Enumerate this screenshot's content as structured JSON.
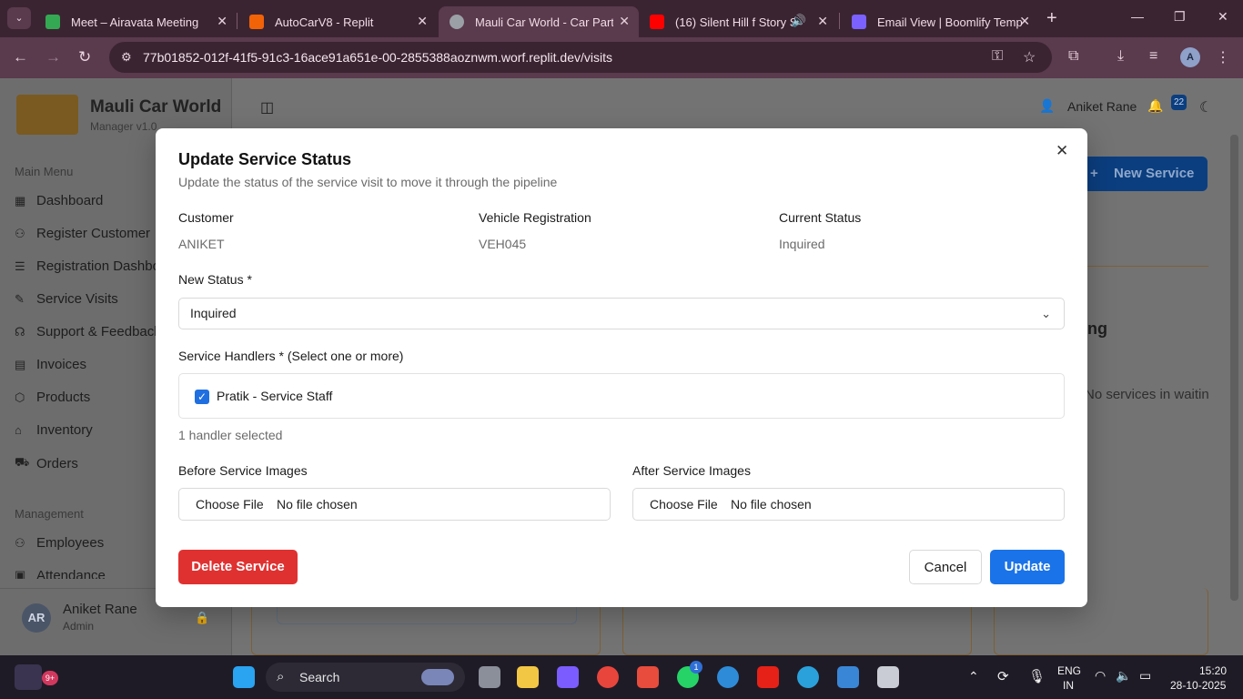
{
  "browser": {
    "tabs": [
      {
        "title": "Meet – Airavata Meeting",
        "favicon_color": "#34a853"
      },
      {
        "title": "AutoCarV8 - Replit",
        "favicon_color": "#f26207"
      },
      {
        "title": "Mauli Car World - Car Parts & ...",
        "favicon_color": "#9aa0a6"
      },
      {
        "title": "(16) Silent Hill f Story Su...",
        "favicon_color": "#ff0000"
      },
      {
        "title": "Email View | Boomlify Tempo...",
        "favicon_color": "#7b61ff"
      }
    ],
    "url": "77b01852-012f-41f5-91c3-16ace91a651e-00-2855388aoznwm.worf.replit.dev/visits",
    "profile_initial": "A"
  },
  "app": {
    "brand": "Mauli Car World",
    "brand_sub": "Manager v1.0",
    "main_menu_label": "Main Menu",
    "menu": [
      "Dashboard",
      "Register Customer",
      "Registration Dashboard",
      "Service Visits",
      "Support & Feedback",
      "Invoices",
      "Products",
      "Inventory",
      "Orders"
    ],
    "management_label": "Management",
    "management": [
      "Employees",
      "Attendance"
    ],
    "user_initials": "AR",
    "user_name": "Aniket Rane",
    "user_role": "Admin",
    "top_user": "Aniket Rane",
    "notif_count": "22",
    "new_service_label": "New Service",
    "bg_heading": "ng",
    "bg_note": "No services in waitin"
  },
  "modal": {
    "title": "Update Service Status",
    "subtitle": "Update the status of the service visit to move it through the pipeline",
    "customer_label": "Customer",
    "customer_value": "ANIKET",
    "vehicle_label": "Vehicle Registration",
    "vehicle_value": "VEH045",
    "status_label": "Current Status",
    "status_value": "Inquired",
    "new_status_label": "New Status *",
    "new_status_value": "Inquired",
    "handlers_label": "Service Handlers * (Select one or more)",
    "handler_option": "Pratik - Service Staff",
    "handler_checked": true,
    "handlers_count": "1 handler selected",
    "before_label": "Before Service Images",
    "after_label": "After Service Images",
    "choose_file": "Choose File",
    "no_file": "No file chosen",
    "delete_label": "Delete Service",
    "cancel_label": "Cancel",
    "update_label": "Update"
  },
  "taskbar": {
    "search_placeholder": "Search",
    "notif_badge": "9+",
    "whatsapp_badge": "1",
    "lang_top": "ENG",
    "lang_bottom": "IN",
    "time": "15:20",
    "date": "28-10-2025"
  }
}
